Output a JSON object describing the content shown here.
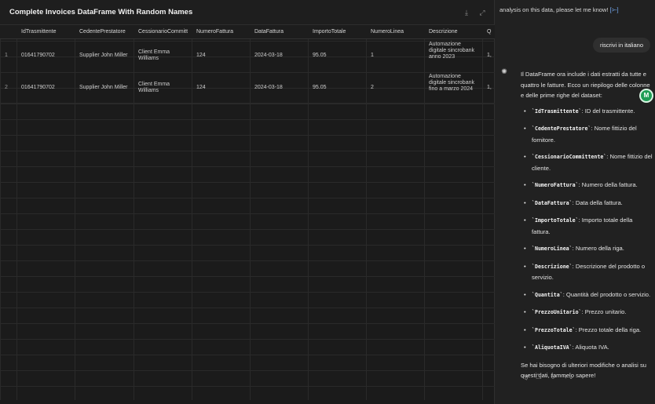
{
  "dataframe": {
    "title": "Complete Invoices DataFrame With Random Names",
    "tools": [
      "download-icon",
      "expand-icon"
    ],
    "columns": [
      "IdTrasmittente",
      "CedentePrestatore",
      "CessionarioCommitt",
      "NumeroFattura",
      "DataFattura",
      "ImportoTotale",
      "NumeroLinea",
      "Descrizione",
      "Q"
    ],
    "rows": [
      {
        "index": "1",
        "cells": [
          "01641790702",
          "Supplier John Miller",
          "Client Emma Williams",
          "124",
          "2024-03-18",
          "95.05",
          "1",
          "Automazione digitale sincrobank anno 2023",
          "1,"
        ]
      },
      {
        "index": "2",
        "cells": [
          "01641790702",
          "Supplier John Miller",
          "Client Emma Williams",
          "124",
          "2024-03-18",
          "95.05",
          "2",
          "Automazione digitale sincrobank fino a marzo 2024",
          "1,"
        ]
      }
    ]
  },
  "chat": {
    "top_text": "analysis on this data, please let me know!",
    "top_link": "[>-]",
    "user_message": "riscrivi in italiano",
    "avatar_letter": "M",
    "intro": "Il DataFrame ora include i dati estratti da tutte e quattro le fatture. Ecco un riepilogo delle colonne e delle prime righe del dataset:",
    "items": [
      {
        "code": "`IdTrasmittente`",
        "text": ": ID del trasmittente."
      },
      {
        "code": "`CedentePrestatore`",
        "text": ": Nome fittizio del fornitore."
      },
      {
        "code": "`CessionarioCommittente`",
        "text": ": Nome fittizio del cliente."
      },
      {
        "code": "`NumeroFattura`",
        "text": ": Numero della fattura."
      },
      {
        "code": "`DataFattura`",
        "text": ": Data della fattura."
      },
      {
        "code": "`ImportoTotale`",
        "text": ": Importo totale della fattura."
      },
      {
        "code": "`NumeroLinea`",
        "text": ": Numero della riga."
      },
      {
        "code": "`Descrizione`",
        "text": ": Descrizione del prodotto o servizio."
      },
      {
        "code": "`Quantita`",
        "text": ": Quantità del prodotto o servizio."
      },
      {
        "code": "`PrezzoUnitario`",
        "text": ": Prezzo unitario."
      },
      {
        "code": "`PrezzoTotale`",
        "text": ": Prezzo totale della riga."
      },
      {
        "code": "`AliquotaIVA`",
        "text": ": Aliquota IVA."
      }
    ],
    "closing": "Se hai bisogno di ulteriori modifiche o analisi su questi dati, fammelo sapere!",
    "actions": [
      "speaker-icon",
      "copy-icon",
      "regenerate-icon",
      "model-switch-icon"
    ]
  }
}
